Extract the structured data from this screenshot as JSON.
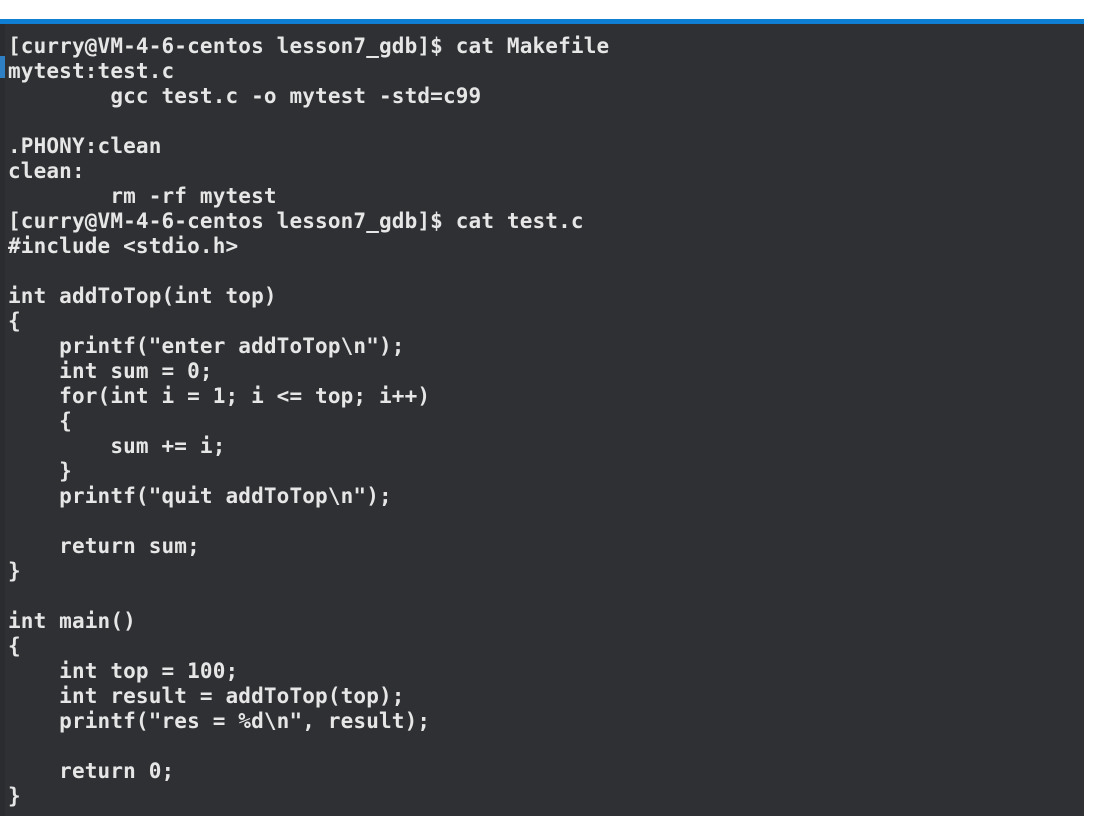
{
  "window": {
    "kind": "terminal-emulator",
    "accent_color": "#0f7fd4",
    "background_color": "#2e3033",
    "foreground_color": "#e6e6e6",
    "page_background": "#ffffff"
  },
  "session": {
    "user": "curry",
    "host": "VM-4-6-centos",
    "directory": "lesson7_gdb",
    "prompt": "[curry@VM-4-6-centos lesson7_gdb]$"
  },
  "commands": [
    "cat Makefile",
    "cat test.c"
  ],
  "terminal": {
    "lines": [
      "[curry@VM-4-6-centos lesson7_gdb]$ cat Makefile",
      "mytest:test.c",
      "        gcc test.c -o mytest -std=c99",
      "",
      ".PHONY:clean",
      "clean:",
      "        rm -rf mytest",
      "[curry@VM-4-6-centos lesson7_gdb]$ cat test.c",
      "#include <stdio.h>",
      "",
      "int addToTop(int top)",
      "{",
      "    printf(\"enter addToTop\\n\");",
      "    int sum = 0;",
      "    for(int i = 1; i <= top; i++)",
      "    {",
      "        sum += i;",
      "    }",
      "    printf(\"quit addToTop\\n\");",
      "",
      "    return sum;",
      "}",
      "",
      "int main()",
      "{",
      "    int top = 100;",
      "    int result = addToTop(top);",
      "    printf(\"res = %d\\n\", result);",
      "",
      "    return 0;",
      "}"
    ]
  }
}
